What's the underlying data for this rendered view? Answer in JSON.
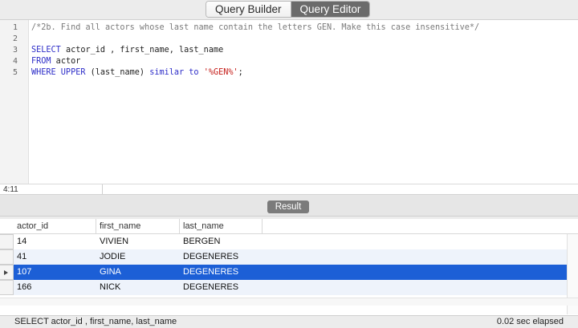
{
  "tabs": [
    {
      "label": "Query Builder",
      "active": false
    },
    {
      "label": "Query Editor",
      "active": true
    }
  ],
  "editor": {
    "line_numbers": [
      "1",
      "2",
      "3",
      "4",
      "5"
    ],
    "cursor_position": "4:11",
    "lines": [
      [
        {
          "t": "/*2b. Find all actors whose last name contain the letters GEN. Make this case insensitive*/",
          "k": "comment"
        }
      ],
      [],
      [
        {
          "t": "SELECT",
          "k": "kw"
        },
        {
          "t": " actor_id , first_name, last_name",
          "k": "id"
        }
      ],
      [
        {
          "t": "FROM",
          "k": "kw"
        },
        {
          "t": " actor",
          "k": "id"
        }
      ],
      [
        {
          "t": "WHERE UPPER",
          "k": "kw"
        },
        {
          "t": " (last_name) ",
          "k": "id"
        },
        {
          "t": "similar to",
          "k": "kw"
        },
        {
          "t": " ",
          "k": "id"
        },
        {
          "t": "'%GEN%'",
          "k": "str"
        },
        {
          "t": ";",
          "k": "id"
        }
      ]
    ]
  },
  "result": {
    "button_label": "Result",
    "columns": [
      "actor_id",
      "first_name",
      "last_name"
    ],
    "rows": [
      [
        "14",
        "VIVIEN",
        "BERGEN"
      ],
      [
        "41",
        "JODIE",
        "DEGENERES"
      ],
      [
        "107",
        "GINA",
        "DEGENERES"
      ],
      [
        "166",
        "NICK",
        "DEGENERES"
      ]
    ],
    "selected_row": 2
  },
  "status": {
    "query": "SELECT actor_id , first_name, last_name",
    "elapsed": "0.02 sec elapsed"
  },
  "colors": {
    "selection": "#1c5fd6",
    "keyword": "#2d2dc8",
    "string": "#c41a16",
    "comment": "#7a7a7a"
  }
}
